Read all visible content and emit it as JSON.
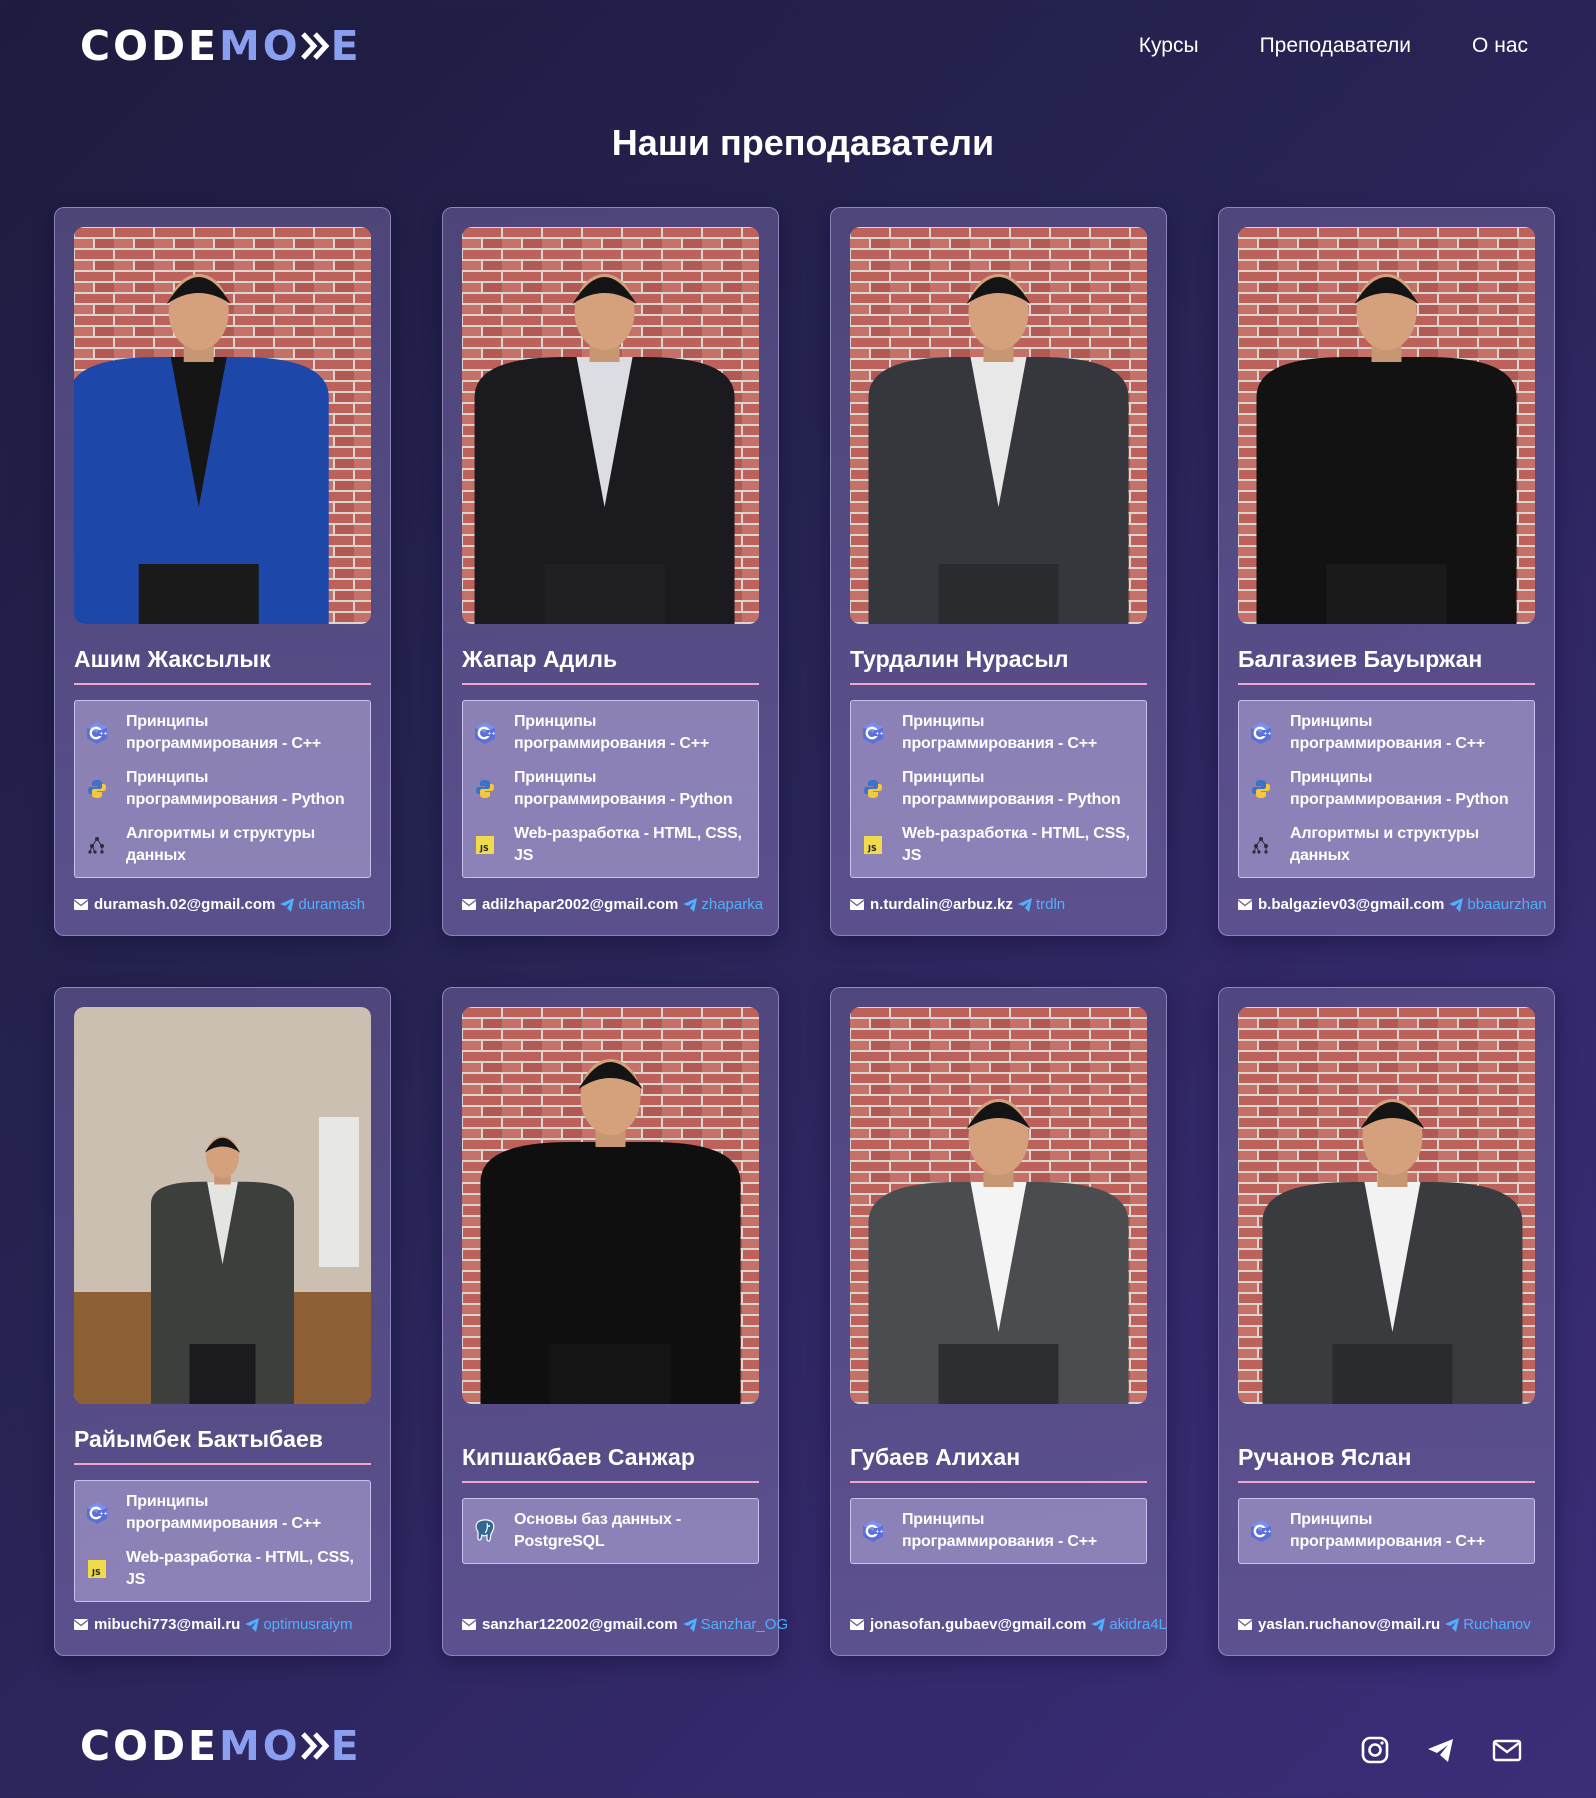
{
  "header": {
    "logo": {
      "part1": "CODE",
      "part2": "MO",
      "part3": "E"
    },
    "nav": [
      "Курсы",
      "Преподаватели",
      "О нас"
    ]
  },
  "page_title": "Наши преподаватели",
  "subjects": {
    "cpp": "Принципы программирования - C++",
    "python": "Принципы программирования - Python",
    "algo": "Алгоритмы и структуры данных",
    "web": "Web-разработка - HTML, CSS, JS",
    "db": "Основы баз данных - PostgreSQL"
  },
  "teachers": [
    {
      "name": "Ашим Жаксылык",
      "email": "duramash.02@gmail.com",
      "telegram": "duramash",
      "subjects": [
        "Принципы программирования - C++",
        "Принципы программирования - Python",
        "Алгоритмы и структуры данных"
      ],
      "subject_icons": [
        "cpp-icon",
        "python-icon",
        "algorithm-icon"
      ]
    },
    {
      "name": "Жапар Адиль",
      "email": "adilzhapar2002@gmail.com",
      "telegram": "zhaparka",
      "subjects": [
        "Принципы программирования - C++",
        "Принципы программирования - Python",
        "Web-разработка - HTML, CSS, JS"
      ],
      "subject_icons": [
        "cpp-icon",
        "python-icon",
        "js-icon"
      ]
    },
    {
      "name": "Турдалин Нурасыл",
      "email": "n.turdalin@arbuz.kz",
      "telegram": "trdln",
      "subjects": [
        "Принципы программирования - C++",
        "Принципы программирования - Python",
        "Web-разработка - HTML, CSS, JS"
      ],
      "subject_icons": [
        "cpp-icon",
        "python-icon",
        "js-icon"
      ]
    },
    {
      "name": "Балгазиев Бауыржан",
      "email": "b.balgaziev03@gmail.com",
      "telegram": "bbaaurzhan",
      "subjects": [
        "Принципы программирования - C++",
        "Принципы программирования - Python",
        "Алгоритмы и структуры данных"
      ],
      "subject_icons": [
        "cpp-icon",
        "python-icon",
        "algorithm-icon"
      ]
    },
    {
      "name": "Райымбек Бактыбаев",
      "email": "mibuchi773@mail.ru",
      "telegram": "optimusraiym",
      "subjects": [
        "Принципы программирования - C++",
        "Web-разработка - HTML, CSS, JS"
      ],
      "subject_icons": [
        "cpp-icon",
        "js-icon"
      ]
    },
    {
      "name": "Кипшакбаев Санжар",
      "email": "sanzhar122002@gmail.com",
      "telegram": "Sanzhar_OG",
      "subjects": [
        "Основы баз данных - PostgreSQL"
      ],
      "subject_icons": [
        "postgresql-icon"
      ]
    },
    {
      "name": "Губаев Алихан",
      "email": "jonasofan.gubaev@gmail.com",
      "telegram": "akidra4L",
      "subjects": [
        "Принципы программирования - C++"
      ],
      "subject_icons": [
        "cpp-icon"
      ]
    },
    {
      "name": "Ручанов Яслан",
      "email": "yaslan.ruchanov@mail.ru",
      "telegram": "Ruchanov",
      "subjects": [
        "Принципы программирования - C++"
      ],
      "subject_icons": [
        "cpp-icon"
      ]
    }
  ],
  "footer": {
    "logo": {
      "part1": "CODE",
      "part2": "MO",
      "part3": "E"
    },
    "socials": [
      "instagram-icon",
      "telegram-icon",
      "mail-icon"
    ]
  },
  "colors": {
    "background": "#262352",
    "accent_blue": "#8b9ff0",
    "underline_pink": "#f2a5cf",
    "telegram_blue": "#4fb0ff"
  }
}
